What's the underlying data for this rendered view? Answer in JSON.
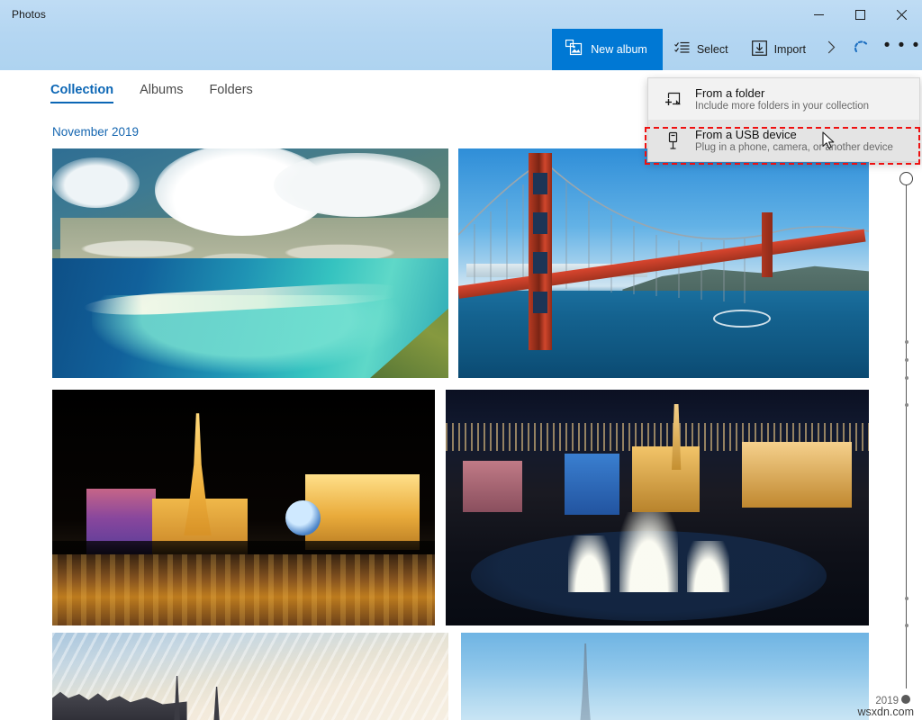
{
  "window": {
    "app_title": "Photos",
    "controls": [
      {
        "name": "minimize",
        "glyph": "minimize-icon"
      },
      {
        "name": "maximize",
        "glyph": "maximize-icon"
      },
      {
        "name": "close",
        "glyph": "close-icon"
      }
    ]
  },
  "toolbar": {
    "new_album_label": "New album",
    "new_album_icon": "new-album-icon",
    "new_album_color": "#0078d4",
    "select_label": "Select",
    "select_icon": "select-checklist-icon",
    "import_label": "Import",
    "import_icon": "import-tray-icon",
    "chevron_icon": "chevron-right-icon",
    "sync_icon": "sync-spinner-icon",
    "more_label": "• • •",
    "more_icon": "more-ellipsis-icon"
  },
  "nav": {
    "tabs": [
      {
        "label": "Collection",
        "active": true
      },
      {
        "label": "Albums",
        "active": false
      },
      {
        "label": "Folders",
        "active": false
      }
    ],
    "active_color": "#0b66b5"
  },
  "content": {
    "date_heading": "November 2019",
    "date_heading_color": "#1566b0",
    "photos": [
      {
        "name": "photo-aerial-coastline",
        "caption": "Aerial view of a tropical coastal city with turquoise bay and clouds"
      },
      {
        "name": "photo-golden-gate-bridge",
        "caption": "Golden Gate Bridge over blue bay with boat wake"
      },
      {
        "name": "photo-vegas-strip-night",
        "caption": "Las Vegas Strip at night with illuminated Eiffel Tower replica reflected in water"
      },
      {
        "name": "photo-bellagio-fountains",
        "caption": "Aerial night view of Bellagio fountains on the Las Vegas Strip"
      },
      {
        "name": "photo-paris-rooftops",
        "caption": "Paris rooftops and spires under a wispy cirrus sky"
      },
      {
        "name": "photo-eiffel-tower-sky",
        "caption": "Distant Eiffel Tower against a clear blue sky"
      }
    ]
  },
  "import_menu": {
    "items": [
      {
        "title": "From a folder",
        "subtitle": "Include more folders in your collection",
        "icon": "folder-add-icon",
        "selected": false
      },
      {
        "title": "From a USB device",
        "subtitle": "Plug in a phone, camera, or another device",
        "icon": "usb-device-icon",
        "selected": true
      }
    ]
  },
  "annotation": {
    "color": "#ee1111",
    "target": "From a USB device"
  },
  "timeline": {
    "year_label": "2019",
    "handle_icon": "scroll-handle-icon",
    "dot_positions": [
      215,
      235,
      255,
      285,
      500,
      530
    ]
  },
  "watermark": {
    "text": "wsxdn.com"
  }
}
